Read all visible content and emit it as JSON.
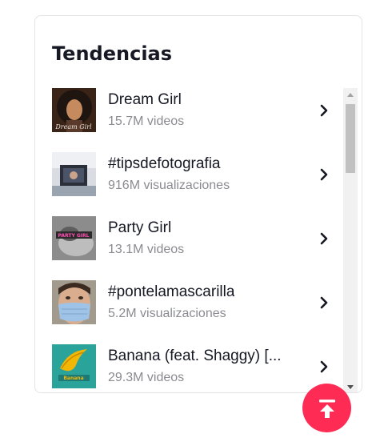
{
  "panel": {
    "title": "Tendencias"
  },
  "trends": [
    {
      "name": "Dream Girl",
      "count": "15.7M videos",
      "thumb": "portrait-curly-hair",
      "thumb_caption": "Dream Girl"
    },
    {
      "name": "#tipsdefotografia",
      "count": "916M visualizaciones",
      "thumb": "camera-on-desk"
    },
    {
      "name": "Party Girl",
      "count": "13.1M videos",
      "thumb": "bw-portrait-pink-text",
      "thumb_caption": "PARTY GIRL"
    },
    {
      "name": "#pontelamascarilla",
      "count": "5.2M visualizaciones",
      "thumb": "person-face-mask"
    },
    {
      "name": "Banana (feat. Shaggy) [...",
      "count": "29.3M videos",
      "thumb": "banana-album-cover",
      "thumb_caption": "Banana"
    }
  ],
  "icons": {
    "chevron": "chevron-right-icon",
    "back_to_top": "arrow-up-to-line-icon"
  },
  "colors": {
    "accent": "#fe2c55",
    "primary_text": "#161823",
    "secondary_text": "#8a8b91"
  }
}
